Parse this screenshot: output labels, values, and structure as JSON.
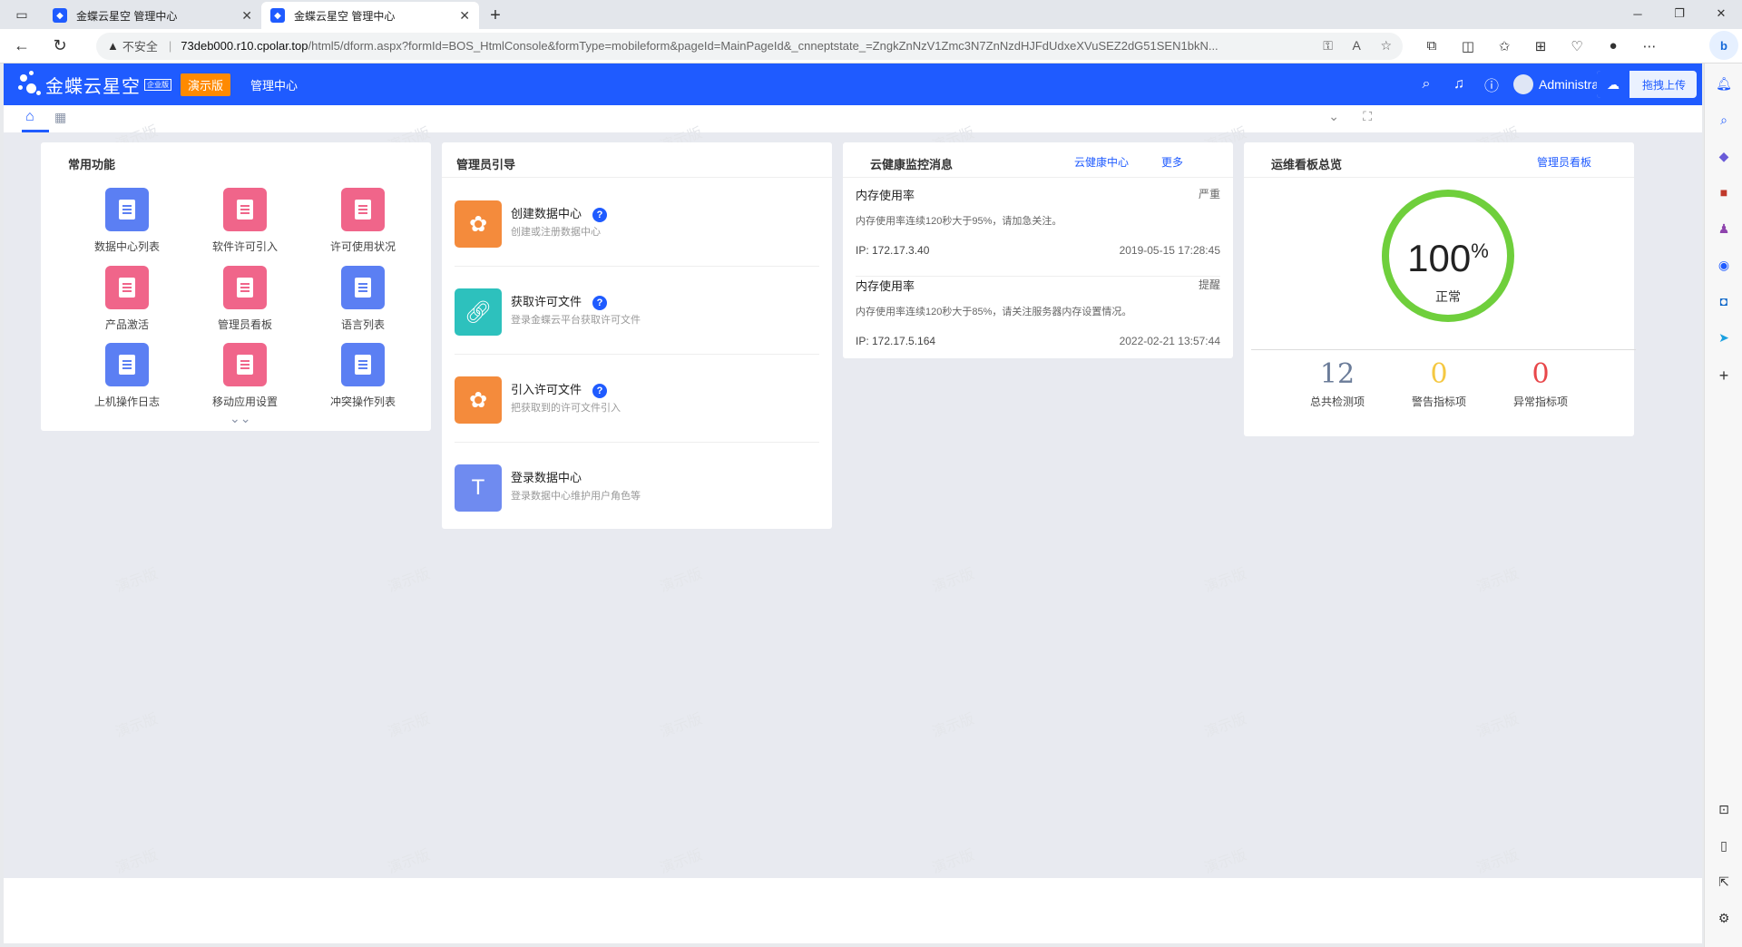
{
  "browser": {
    "tabs": [
      {
        "title": "金蝶云星空 管理中心"
      },
      {
        "title": "金蝶云星空 管理中心"
      }
    ],
    "url": {
      "insecure_label": "不安全",
      "host": "73deb000.r10.cpolar.top",
      "path": "/html5/dform.aspx?formId=BOS_HtmlConsole&formType=mobileform&pageId=MainPageId&_cnneptstate_=ZngkZnNzV1Zmc3N7ZnNzdHJFdUdxeXVuSEZ2dG51SEN1bkN..."
    }
  },
  "header": {
    "logo_text": "金蝶云星空",
    "edition_badge": "企业版",
    "demo_badge": "演示版",
    "title": "管理中心",
    "user_name": "Administrator",
    "upload_label": "拖拽上传"
  },
  "common_functions": {
    "title": "常用功能",
    "items": [
      {
        "label": "数据中心列表",
        "color": "blue"
      },
      {
        "label": "软件许可引入",
        "color": "pink"
      },
      {
        "label": "许可使用状况",
        "color": "pink"
      },
      {
        "label": "产品激活",
        "color": "pink"
      },
      {
        "label": "管理员看板",
        "color": "pink"
      },
      {
        "label": "语言列表",
        "color": "blue"
      },
      {
        "label": "上机操作日志",
        "color": "blue"
      },
      {
        "label": "移动应用设置",
        "color": "pink"
      },
      {
        "label": "冲突操作列表",
        "color": "blue"
      }
    ]
  },
  "admin_guide": {
    "title": "管理员引导",
    "items": [
      {
        "title": "创建数据中心",
        "desc": "创建或注册数据中心",
        "has_help": true
      },
      {
        "title": "获取许可文件",
        "desc": "登录金蝶云平台获取许可文件",
        "has_help": true
      },
      {
        "title": "引入许可文件",
        "desc": "把获取到的许可文件引入",
        "has_help": true
      },
      {
        "title": "登录数据中心",
        "desc": "登录数据中心维护用户角色等",
        "has_help": false
      }
    ]
  },
  "cloud_health": {
    "title": "云健康监控消息",
    "link_center": "云健康中心",
    "link_more": "更多",
    "messages": [
      {
        "title": "内存使用率",
        "level": "严重",
        "text": "内存使用率连续120秒大于95%，请加急关注。",
        "ip": "IP: 172.17.3.40",
        "time": "2019-05-15 17:28:45"
      },
      {
        "title": "内存使用率",
        "level": "提醒",
        "text": "内存使用率连续120秒大于85%，请关注服务器内存设置情况。",
        "ip": "IP: 172.17.5.164",
        "time": "2022-02-21 13:57:44"
      }
    ]
  },
  "ops_dashboard": {
    "title": "运维看板总览",
    "link": "管理员看板",
    "gauge_value": "100",
    "gauge_unit": "%",
    "gauge_status": "正常",
    "stats": [
      {
        "value": "12",
        "label": "总共检测项",
        "color": "#6b7c99"
      },
      {
        "value": "0",
        "label": "警告指标项",
        "color": "#f5c842"
      },
      {
        "value": "0",
        "label": "异常指标项",
        "color": "#e8474a"
      }
    ]
  },
  "watermark_text": "演示版",
  "colors": {
    "brand": "#1f5bff",
    "demo_badge": "#ff8a00",
    "gauge_ring": "#6fcf3c"
  }
}
